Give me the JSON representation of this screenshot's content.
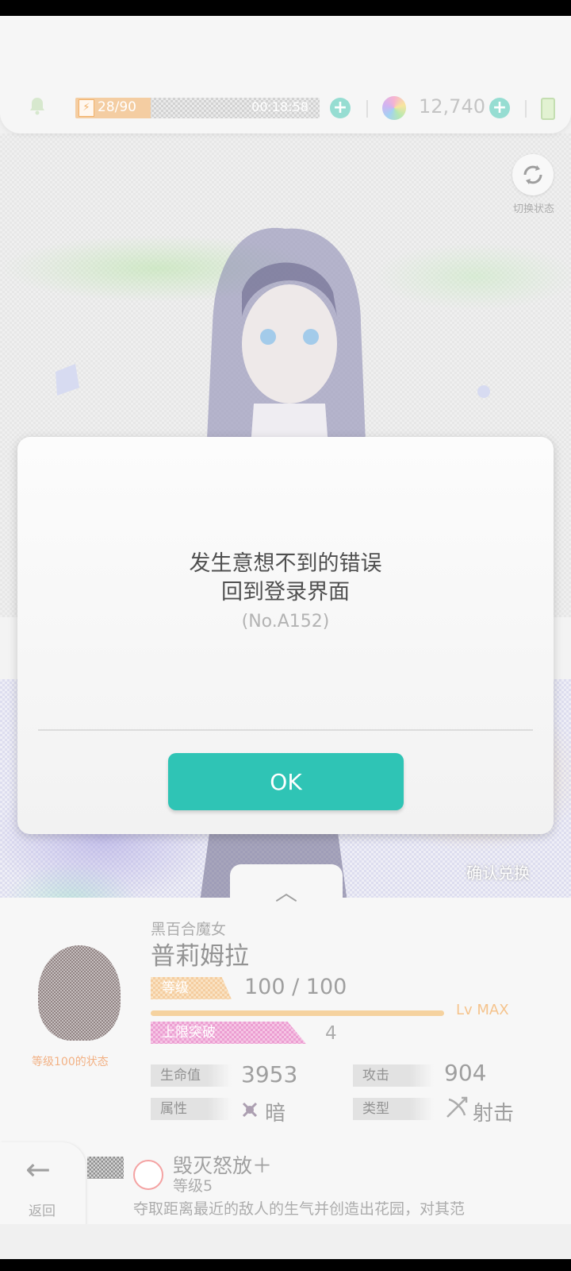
{
  "header": {
    "stamina": "28/90",
    "stamina_fraction": 0.31,
    "timer": "00:18:58",
    "gems": "12,740"
  },
  "hero": {
    "switch_label": "切换状态",
    "confirm_label": "确认兑换"
  },
  "character": {
    "title": "黑百合魔女",
    "name": "普莉姆拉",
    "avatar_caption": "等级100的状态",
    "level_tag": "等级",
    "level_value": "100 / 100",
    "level_max": "Lv MAX",
    "limit_tag": "上限突破",
    "limit_value": "4",
    "stats": {
      "hp_label": "生命值",
      "hp_value": "3953",
      "atk_label": "攻击",
      "atk_value": "904",
      "attr_label": "属性",
      "attr_value": "暗",
      "type_label": "类型",
      "type_value": "射击"
    }
  },
  "skill": {
    "name": "毁灭怒放＋",
    "level": "等级5",
    "desc": "夺取距离最近的敌人的生气并创造出花园，对其范"
  },
  "nav": {
    "back_label": "返回"
  },
  "dialog": {
    "line1": "发生意想不到的错误",
    "line2": "回到登录界面",
    "code": "(No.A152)",
    "ok_label": "OK"
  },
  "colors": {
    "accent": "#2fc4b5",
    "level_orange": "#f3c28a",
    "limit_pink": "#e889c9"
  }
}
